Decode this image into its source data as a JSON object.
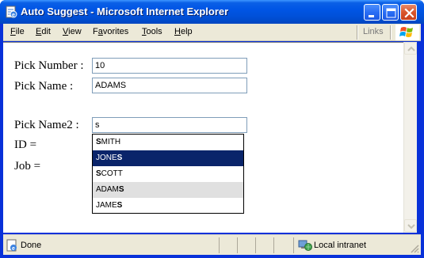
{
  "window": {
    "title": "Auto Suggest - Microsoft Internet Explorer"
  },
  "menubar": {
    "items": [
      {
        "accel": "F",
        "rest": "ile"
      },
      {
        "accel": "E",
        "rest": "dit"
      },
      {
        "accel": "V",
        "rest": "iew"
      },
      {
        "accel": "",
        "pre": "F",
        "accel2": "a",
        "rest": "vorites"
      },
      {
        "accel": "T",
        "rest": "ools"
      },
      {
        "accel": "H",
        "rest": "elp"
      }
    ],
    "links_label": "Links"
  },
  "form": {
    "pick_number_label": "Pick Number :",
    "pick_number_value": "10",
    "pick_name_label": "Pick Name :",
    "pick_name_value": "ADAMS",
    "pick_name2_label": "Pick Name2 :",
    "pick_name2_value": "s",
    "id_label": "ID =",
    "job_label": "Job ="
  },
  "suggestions": [
    {
      "pre": "",
      "bold": "S",
      "post": "MITH",
      "state": "normal"
    },
    {
      "pre": "JONE",
      "bold": "S",
      "post": "",
      "state": "selected"
    },
    {
      "pre": "",
      "bold": "S",
      "post": "COTT",
      "state": "normal"
    },
    {
      "pre": "ADAM",
      "bold": "S",
      "post": "",
      "state": "hover"
    },
    {
      "pre": "JAME",
      "bold": "S",
      "post": "",
      "state": "normal"
    }
  ],
  "statusbar": {
    "status_text": "Done",
    "zone_text": "Local intranet"
  },
  "colors": {
    "titlebar": "#0055e5",
    "selection": "#0a246a",
    "hover": "#e0e0e0",
    "input_border": "#7f9db9"
  },
  "icons": {
    "app": "ie-page-icon",
    "minimize": "minimize-icon",
    "maximize": "maximize-icon",
    "close": "close-icon",
    "logo": "windows-flag-icon",
    "status": "page-done-icon",
    "zone": "local-intranet-icon"
  }
}
